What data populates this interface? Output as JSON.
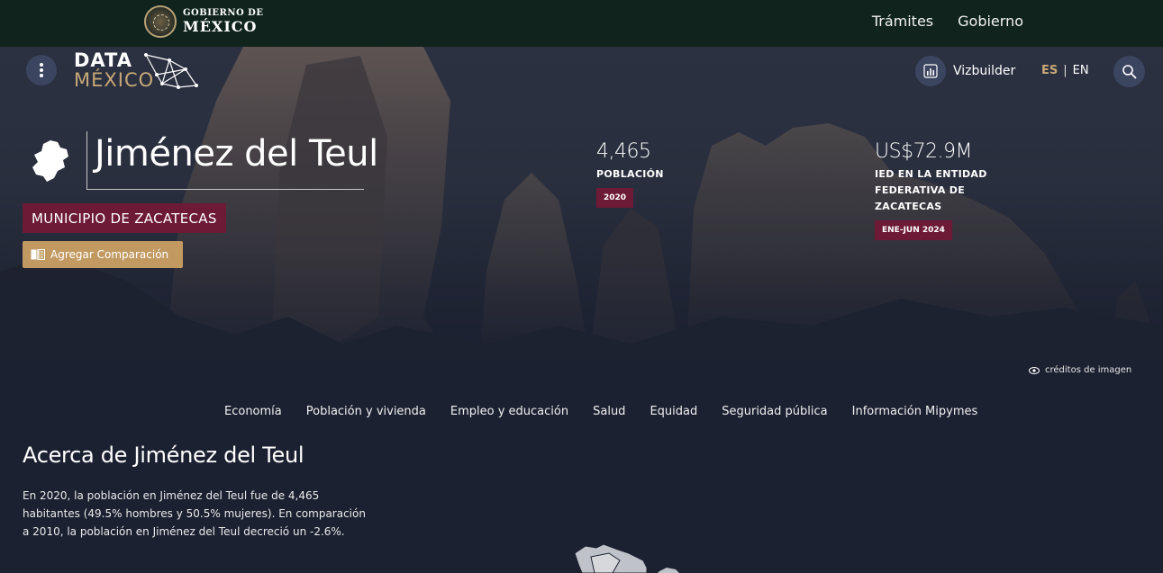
{
  "gov_header": {
    "logo_line1": "GOBIERNO DE",
    "logo_line2": "MÉXICO",
    "nav": [
      "Trámites",
      "Gobierno"
    ]
  },
  "site_header": {
    "logo_line1": "DATA",
    "logo_line2": "MÉXICO",
    "vizbuilder_label": "Vizbuilder",
    "lang_es": "ES",
    "lang_sep": "|",
    "lang_en": "EN"
  },
  "profile": {
    "title": "Jiménez del Teul",
    "type_badge": "MUNICIPIO DE ZACATECAS",
    "compare_label": "Agregar Comparación"
  },
  "stats": [
    {
      "value": "4,465",
      "label": "POBLACIÓN",
      "badge": "2020"
    },
    {
      "value": "US$72.9M",
      "label": "IED EN LA ENTIDAD FEDERATIVA DE ZACATECAS",
      "badge": "ENE-JUN 2024"
    }
  ],
  "image_credits": "créditos de imagen",
  "subnav": [
    "Economía",
    "Población y vivienda",
    "Empleo y educación",
    "Salud",
    "Equidad",
    "Seguridad pública",
    "Información Mipymes"
  ],
  "about": {
    "title": "Acerca de Jiménez del Teul",
    "text": "En 2020, la población en Jiménez del Teul fue de 4,465 habitantes (49.5% hombres y 50.5% mujeres). En comparación a 2010, la población en Jiménez del Teul decreció un -2.6%."
  },
  "colors": {
    "gov_bar": "#10231d",
    "badge": "#6d1a37",
    "compare_button": "#c29a61",
    "accent_gold": "#c8a877",
    "page_bg": "#1c2131"
  }
}
